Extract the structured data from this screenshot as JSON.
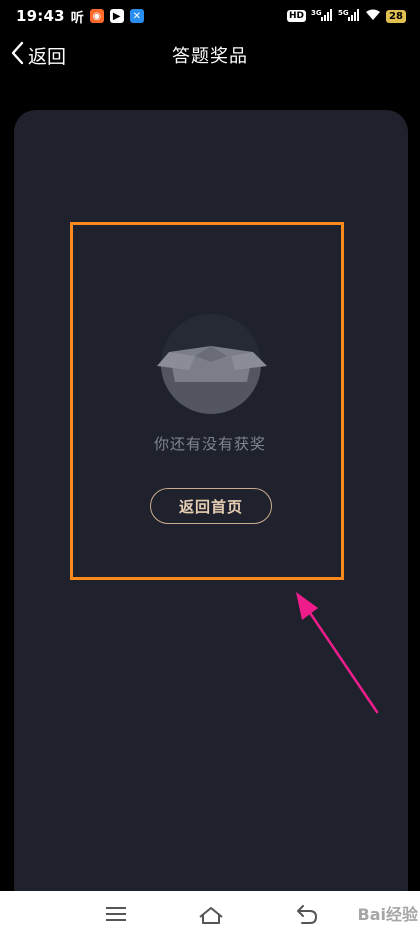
{
  "status_bar": {
    "time": "19:43",
    "app_icon_text": "听",
    "network_3g": "3G",
    "network_5g": "5G",
    "hd_badge": "HD",
    "battery": "28"
  },
  "nav": {
    "back_label": "返回",
    "title": "答题奖品"
  },
  "empty_state": {
    "message": "你还有没有获奖",
    "home_button_label": "返回首页"
  },
  "watermark": {
    "text": "Bai经验"
  },
  "colors": {
    "background": "#000000",
    "card": "#1f222c",
    "highlight": "#ff8a1c",
    "arrow": "#ef1d8c",
    "button_border": "#c9ab8d"
  }
}
